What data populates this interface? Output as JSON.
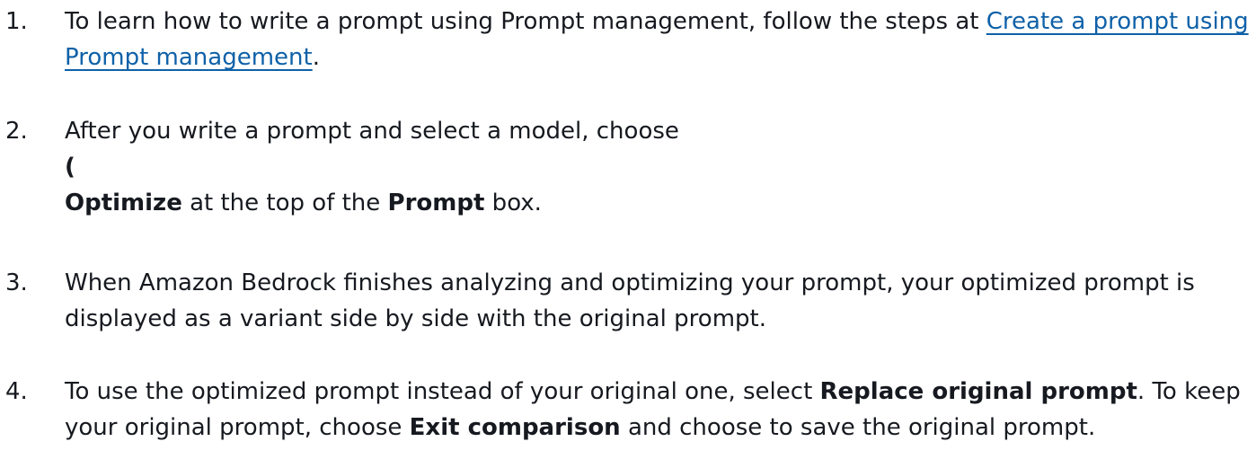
{
  "steps": [
    {
      "number": "1.",
      "text_before": "To learn how to write a prompt using Prompt management, follow the steps at ",
      "link": "Create a prompt using Prompt management",
      "text_after": "."
    },
    {
      "number": "2.",
      "line1": "After you write a prompt and select a model, choose",
      "paren": "(",
      "bold_optimize": "Optimize",
      "mid": " at the top of the ",
      "bold_prompt": "Prompt",
      "end": " box."
    },
    {
      "number": "3.",
      "text": "When Amazon Bedrock finishes analyzing and optimizing your prompt, your optimized prompt is displayed as a variant side by side with the original prompt."
    },
    {
      "number": "4.",
      "text1": "To use the optimized prompt instead of your original one, select ",
      "bold_replace": "Replace original prompt",
      "text2": ". To keep your original prompt, choose ",
      "bold_exit": "Exit comparison",
      "text3": " and choose to save the original prompt."
    }
  ]
}
